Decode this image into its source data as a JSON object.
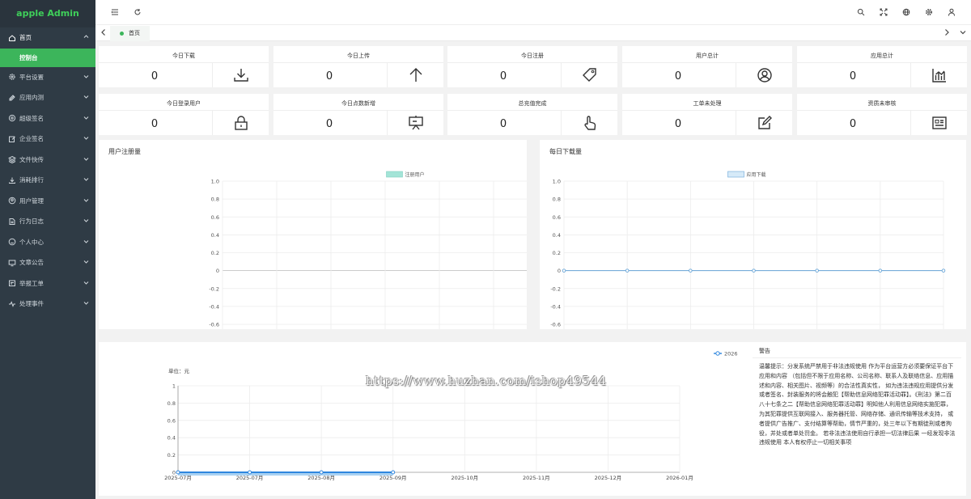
{
  "app": {
    "title": "apple Admin"
  },
  "sidebar": {
    "items": [
      {
        "label": "首页",
        "icon": "home-icon",
        "active": true
      },
      {
        "label": "平台设置",
        "icon": "settings-icon"
      },
      {
        "label": "应用内测",
        "icon": "test-icon"
      },
      {
        "label": "超级签名",
        "icon": "signature-icon"
      },
      {
        "label": "企业签名",
        "icon": "edit-icon"
      },
      {
        "label": "文件快传",
        "icon": "layers-icon"
      },
      {
        "label": "消耗排行",
        "icon": "download-icon"
      },
      {
        "label": "用户管理",
        "icon": "user-icon"
      },
      {
        "label": "行为日志",
        "icon": "doc-icon"
      },
      {
        "label": "个人中心",
        "icon": "smile-icon"
      },
      {
        "label": "文章公告",
        "icon": "monitor-icon"
      },
      {
        "label": "举报工单",
        "icon": "report-icon"
      },
      {
        "label": "处理事件",
        "icon": "pulse-icon"
      }
    ],
    "sub_item": "控制台"
  },
  "tabs": {
    "home": "首页"
  },
  "stats": [
    {
      "title": "今日下载",
      "value": "0",
      "icon": "download-icon"
    },
    {
      "title": "今日上传",
      "value": "0",
      "icon": "upload-arrow-icon"
    },
    {
      "title": "今日注册",
      "value": "0",
      "icon": "tag-icon"
    },
    {
      "title": "用户总计",
      "value": "0",
      "icon": "user-circle-icon"
    },
    {
      "title": "应用总计",
      "value": "0",
      "icon": "bar-chart-icon"
    },
    {
      "title": "今日登录用户",
      "value": "0",
      "icon": "lock-icon"
    },
    {
      "title": "今日点数新增",
      "value": "0",
      "icon": "presentation-icon"
    },
    {
      "title": "总充值完成",
      "value": "0",
      "icon": "hand-pointer-icon"
    },
    {
      "title": "工单未处理",
      "value": "0",
      "icon": "edit-square-icon"
    },
    {
      "title": "资质未审核",
      "value": "0",
      "icon": "id-card-icon"
    }
  ],
  "chart_data": [
    {
      "type": "line",
      "title": "用户注册量",
      "series": [
        {
          "name": "注册用户",
          "values": []
        }
      ],
      "ylim": [
        -0.6,
        1.0
      ],
      "yticks": [
        "1.0",
        "0.8",
        "0.6",
        "0.4",
        "0.2",
        "0",
        "-0.2",
        "-0.4",
        "-0.6"
      ],
      "legend": "top-center",
      "color": "#a3e4d7"
    },
    {
      "type": "line",
      "title": "每日下载量",
      "series": [
        {
          "name": "应用下载",
          "values": [
            0,
            0,
            0,
            0,
            0,
            0,
            0
          ]
        }
      ],
      "ylim": [
        -0.6,
        1.0
      ],
      "yticks": [
        "1.0",
        "0.8",
        "0.6",
        "0.4",
        "0.2",
        "0",
        "-0.2",
        "-0.4",
        "-0.6"
      ],
      "legend": "top-center",
      "color": "#d6eaf8"
    },
    {
      "type": "line",
      "ylabel": "单位：元",
      "x": [
        "2025-07月",
        "2025-07月",
        "2025-08月",
        "2025-09月",
        "2025-10月",
        "2025-11月",
        "2025-12月",
        "2026-01月"
      ],
      "series": [
        {
          "name": "2026",
          "values": [
            0,
            0,
            0,
            0
          ]
        }
      ],
      "ylim": [
        0,
        1
      ],
      "yticks": [
        "1",
        "0.8",
        "0.6",
        "0.4",
        "0.2",
        "0"
      ],
      "legend": "top-right",
      "color": "#2e86de"
    }
  ],
  "warning": {
    "title": "警告",
    "lines": [
      "温馨提示：分发系统严禁用于非法违规使用 作为平台运营方必须要保证平台下",
      "应用和内容 （包括但不限于应用名称、公司名称、联系人及联络信息、应用描",
      "述和内容、相关图片、视频等）的合法性真实性， 如为违法违规应用提供分发",
      "或者签名、封装服务的将会触犯【帮助信息网络犯罪活动罪】。《刑法》第二百",
      "八十七条之二【帮助信息网络犯罪活动罪】明知他人利用信息网络实施犯罪，",
      "为其犯罪提供互联网接入、服务器托管、网络存储、通讯传输等技术支持， 或",
      "者提供广告推广、支付结算等帮助，情节严重的，处三年以下有期徒刑或者拘",
      "役，并处或者单处罚金。 若非法违法使用自行承担一切法律后果 一经发现非法",
      "违规使用 本人有权停止一切相关事项"
    ]
  },
  "watermark": "https://www.huzhan.com/ishop49544"
}
